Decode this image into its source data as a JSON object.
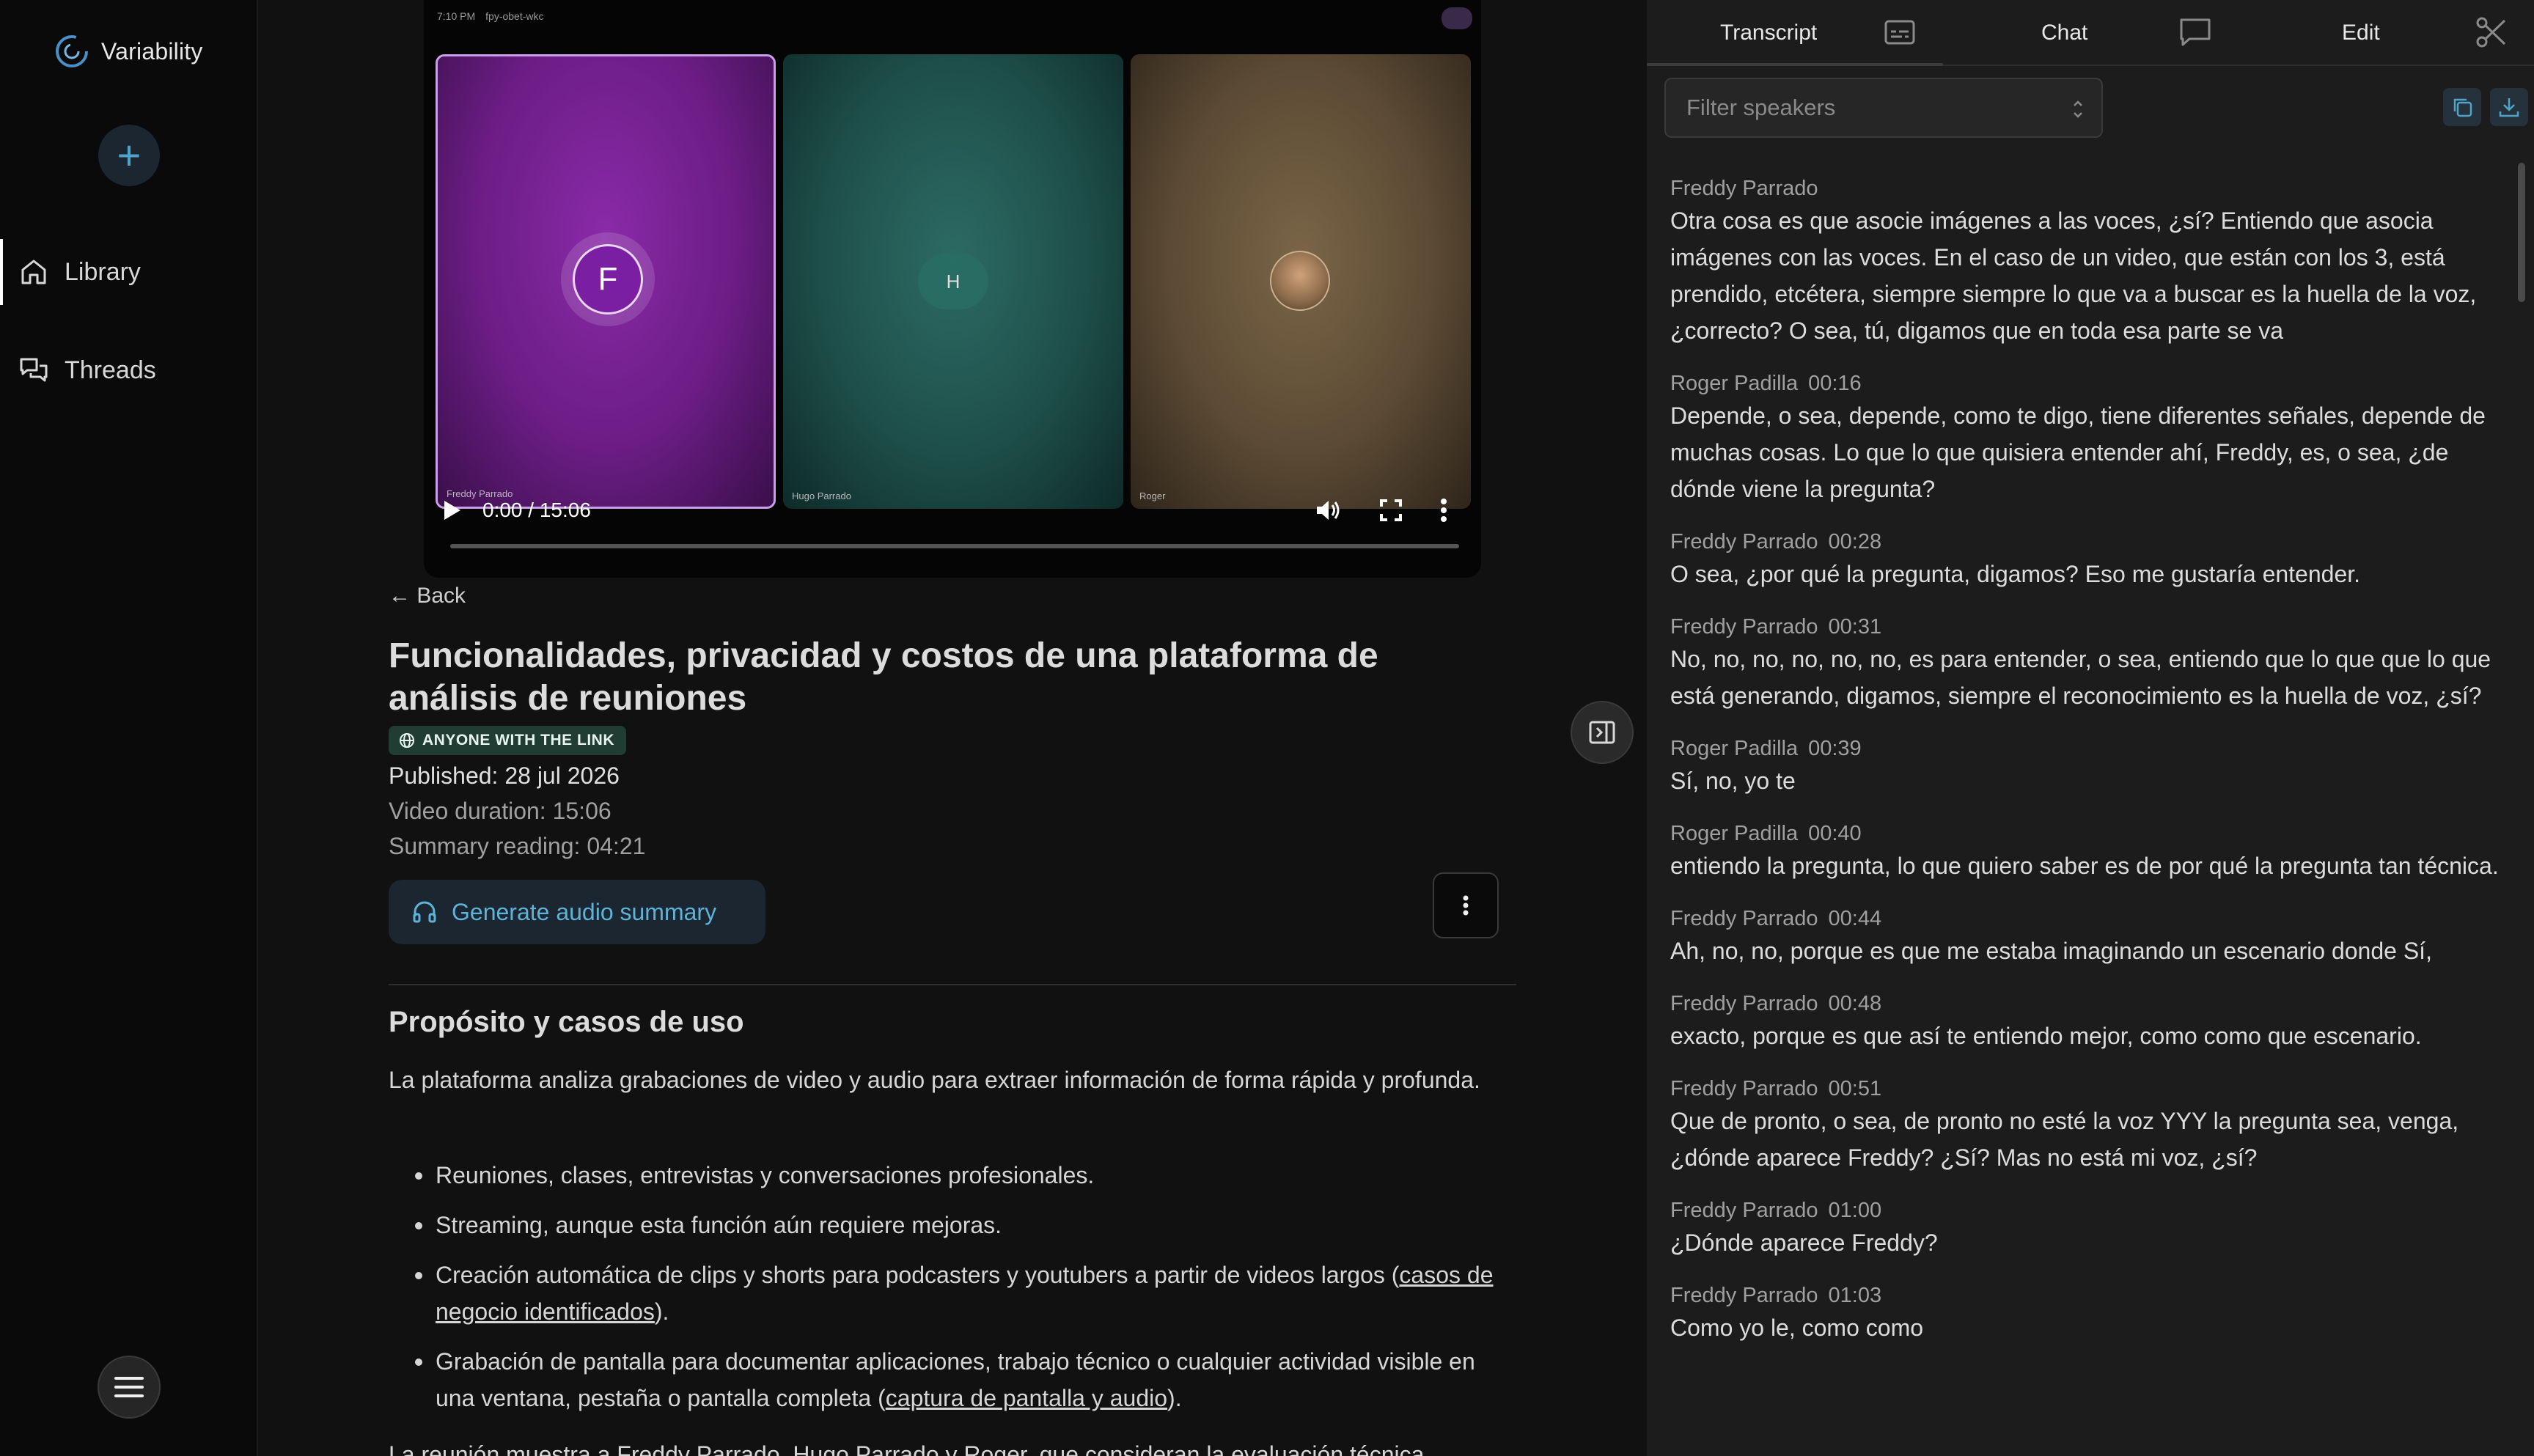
{
  "app": {
    "name": "Variability"
  },
  "sidebar": {
    "new_label": "+",
    "items": [
      {
        "label": "Library",
        "icon": "home-icon",
        "active": true
      },
      {
        "label": "Threads",
        "icon": "chat-bubbles-icon",
        "active": false
      }
    ]
  },
  "video": {
    "topbar_time": "7:10 PM",
    "topbar_meeting": "fpy-obet-wkc",
    "participants": [
      {
        "name": "Freddy Parrado",
        "initial": "F"
      },
      {
        "name": "Hugo Parrado",
        "initial": "H"
      },
      {
        "name": "Roger",
        "initial": ""
      }
    ],
    "time_display": "0:00 / 15:06",
    "progress": 0
  },
  "meeting": {
    "back_label": "← Back",
    "title": "Funcionalidades, privacidad y costos de una plataforma de análisis de reuniones",
    "share_badge": "ANYONE WITH THE LINK",
    "published": "Published: 28 jul 2026",
    "duration": "Video duration: 15:06",
    "reading": "Summary reading: 04:21",
    "audio_button": "Generate audio summary"
  },
  "summary": {
    "section_title": "Propósito y casos de uso",
    "intro": "La plataforma analiza grabaciones de video y audio para extraer información de forma rápida y profunda.",
    "bullets": [
      {
        "text": "Reuniones, clases, entrevistas y conversaciones profesionales.",
        "link": "",
        "suffix": ""
      },
      {
        "text": "Streaming, aunque esta función aún requiere mejoras.",
        "link": "",
        "suffix": ""
      },
      {
        "text": "Creación automática de clips y shorts para podcasters y youtubers a partir de videos largos (",
        "link": "casos de negocio identificados",
        "suffix": ")."
      },
      {
        "text": "Grabación de pantalla para documentar aplicaciones, trabajo técnico o cualquier actividad visible en una ventana, pestaña o pantalla completa (",
        "link": "captura de pantalla y audio",
        "suffix": ")."
      }
    ],
    "cut_line": "La reunión muestra a Freddy Parrado, Hugo Parrado y Roger, que consideran la evaluación técnica"
  },
  "panel": {
    "tabs": [
      {
        "label": "Transcript",
        "icon": "subtitles-icon"
      },
      {
        "label": "Chat",
        "icon": "chat-icon"
      },
      {
        "label": "Edit",
        "icon": "scissors-icon"
      }
    ],
    "filter_placeholder": "Filter speakers",
    "transcript": [
      {
        "speaker": "Freddy Parrado",
        "time": "",
        "text": "Otra cosa es que asocie imágenes a las voces, ¿sí? Entiendo que asocia imágenes con las voces. En el caso de un video, que están con los 3, está prendido, etcétera, siempre siempre lo que va a buscar es la huella de la voz, ¿correcto? O sea, tú, digamos que en toda esa parte se va"
      },
      {
        "speaker": "Roger Padilla",
        "time": "00:16",
        "text": "Depende, o sea, depende, como te digo, tiene diferentes señales, depende de muchas cosas. Lo que lo que quisiera entender ahí, Freddy, es, o sea, ¿de dónde viene la pregunta?"
      },
      {
        "speaker": "Freddy Parrado",
        "time": "00:28",
        "text": "O sea, ¿por qué la pregunta, digamos? Eso me gustaría entender."
      },
      {
        "speaker": "Freddy Parrado",
        "time": "00:31",
        "text": "No, no, no, no, no, no, es para entender, o sea, entiendo que lo que que lo que está generando, digamos, siempre el reconocimiento es la huella de voz, ¿sí?"
      },
      {
        "speaker": "Roger Padilla",
        "time": "00:39",
        "text": "Sí, no, yo te"
      },
      {
        "speaker": "Roger Padilla",
        "time": "00:40",
        "text": "entiendo la pregunta, lo que quiero saber es de por qué la pregunta tan técnica."
      },
      {
        "speaker": "Freddy Parrado",
        "time": "00:44",
        "text": "Ah, no, no, porque es que me estaba imaginando un escenario donde Sí,"
      },
      {
        "speaker": "Freddy Parrado",
        "time": "00:48",
        "text": "exacto, porque es que así te entiendo mejor, como como que escenario."
      },
      {
        "speaker": "Freddy Parrado",
        "time": "00:51",
        "text": "Que de pronto, o sea, de pronto no esté la voz YYY la pregunta sea, venga, ¿dónde aparece Freddy? ¿Sí? Mas no está mi voz, ¿sí?"
      },
      {
        "speaker": "Freddy Parrado",
        "time": "01:00",
        "text": "¿Dónde aparece Freddy?"
      },
      {
        "speaker": "Freddy Parrado",
        "time": "01:03",
        "text": "Como yo le, como como"
      }
    ]
  },
  "colors": {
    "accent": "#4fa5c9",
    "badge_bg": "#1f3d33",
    "panel_bg": "#1c1c1c"
  }
}
